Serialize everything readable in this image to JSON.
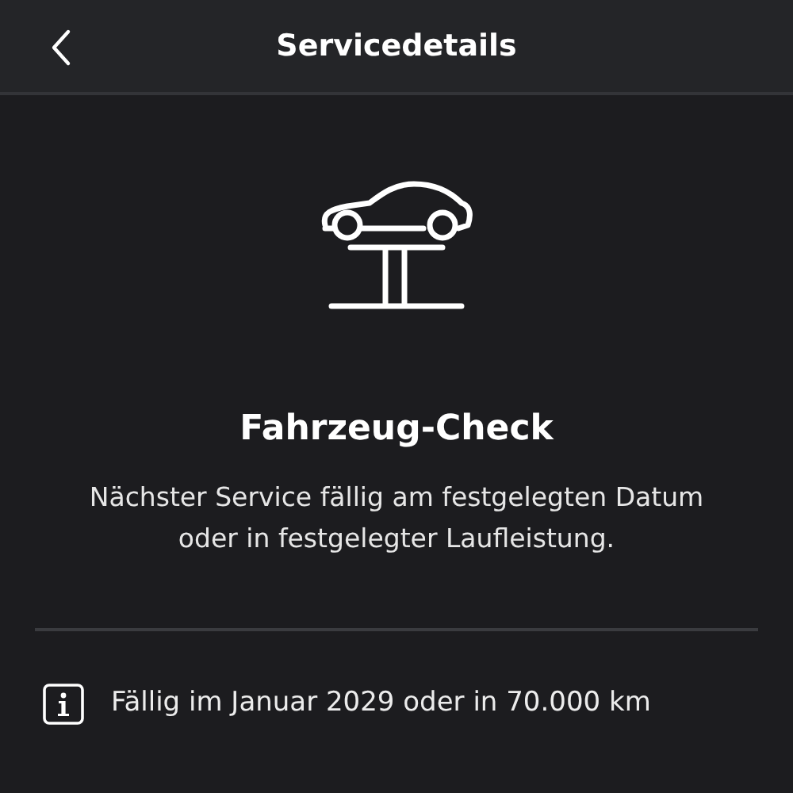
{
  "header": {
    "title": "Servicedetails"
  },
  "service": {
    "title": "Fahrzeug-Check",
    "description": "Nächster Service fällig am festgelegten Datum oder in festgelegter Laufleistung."
  },
  "info": {
    "text": "Fällig im Januar 2029 oder in 70.000 km"
  }
}
